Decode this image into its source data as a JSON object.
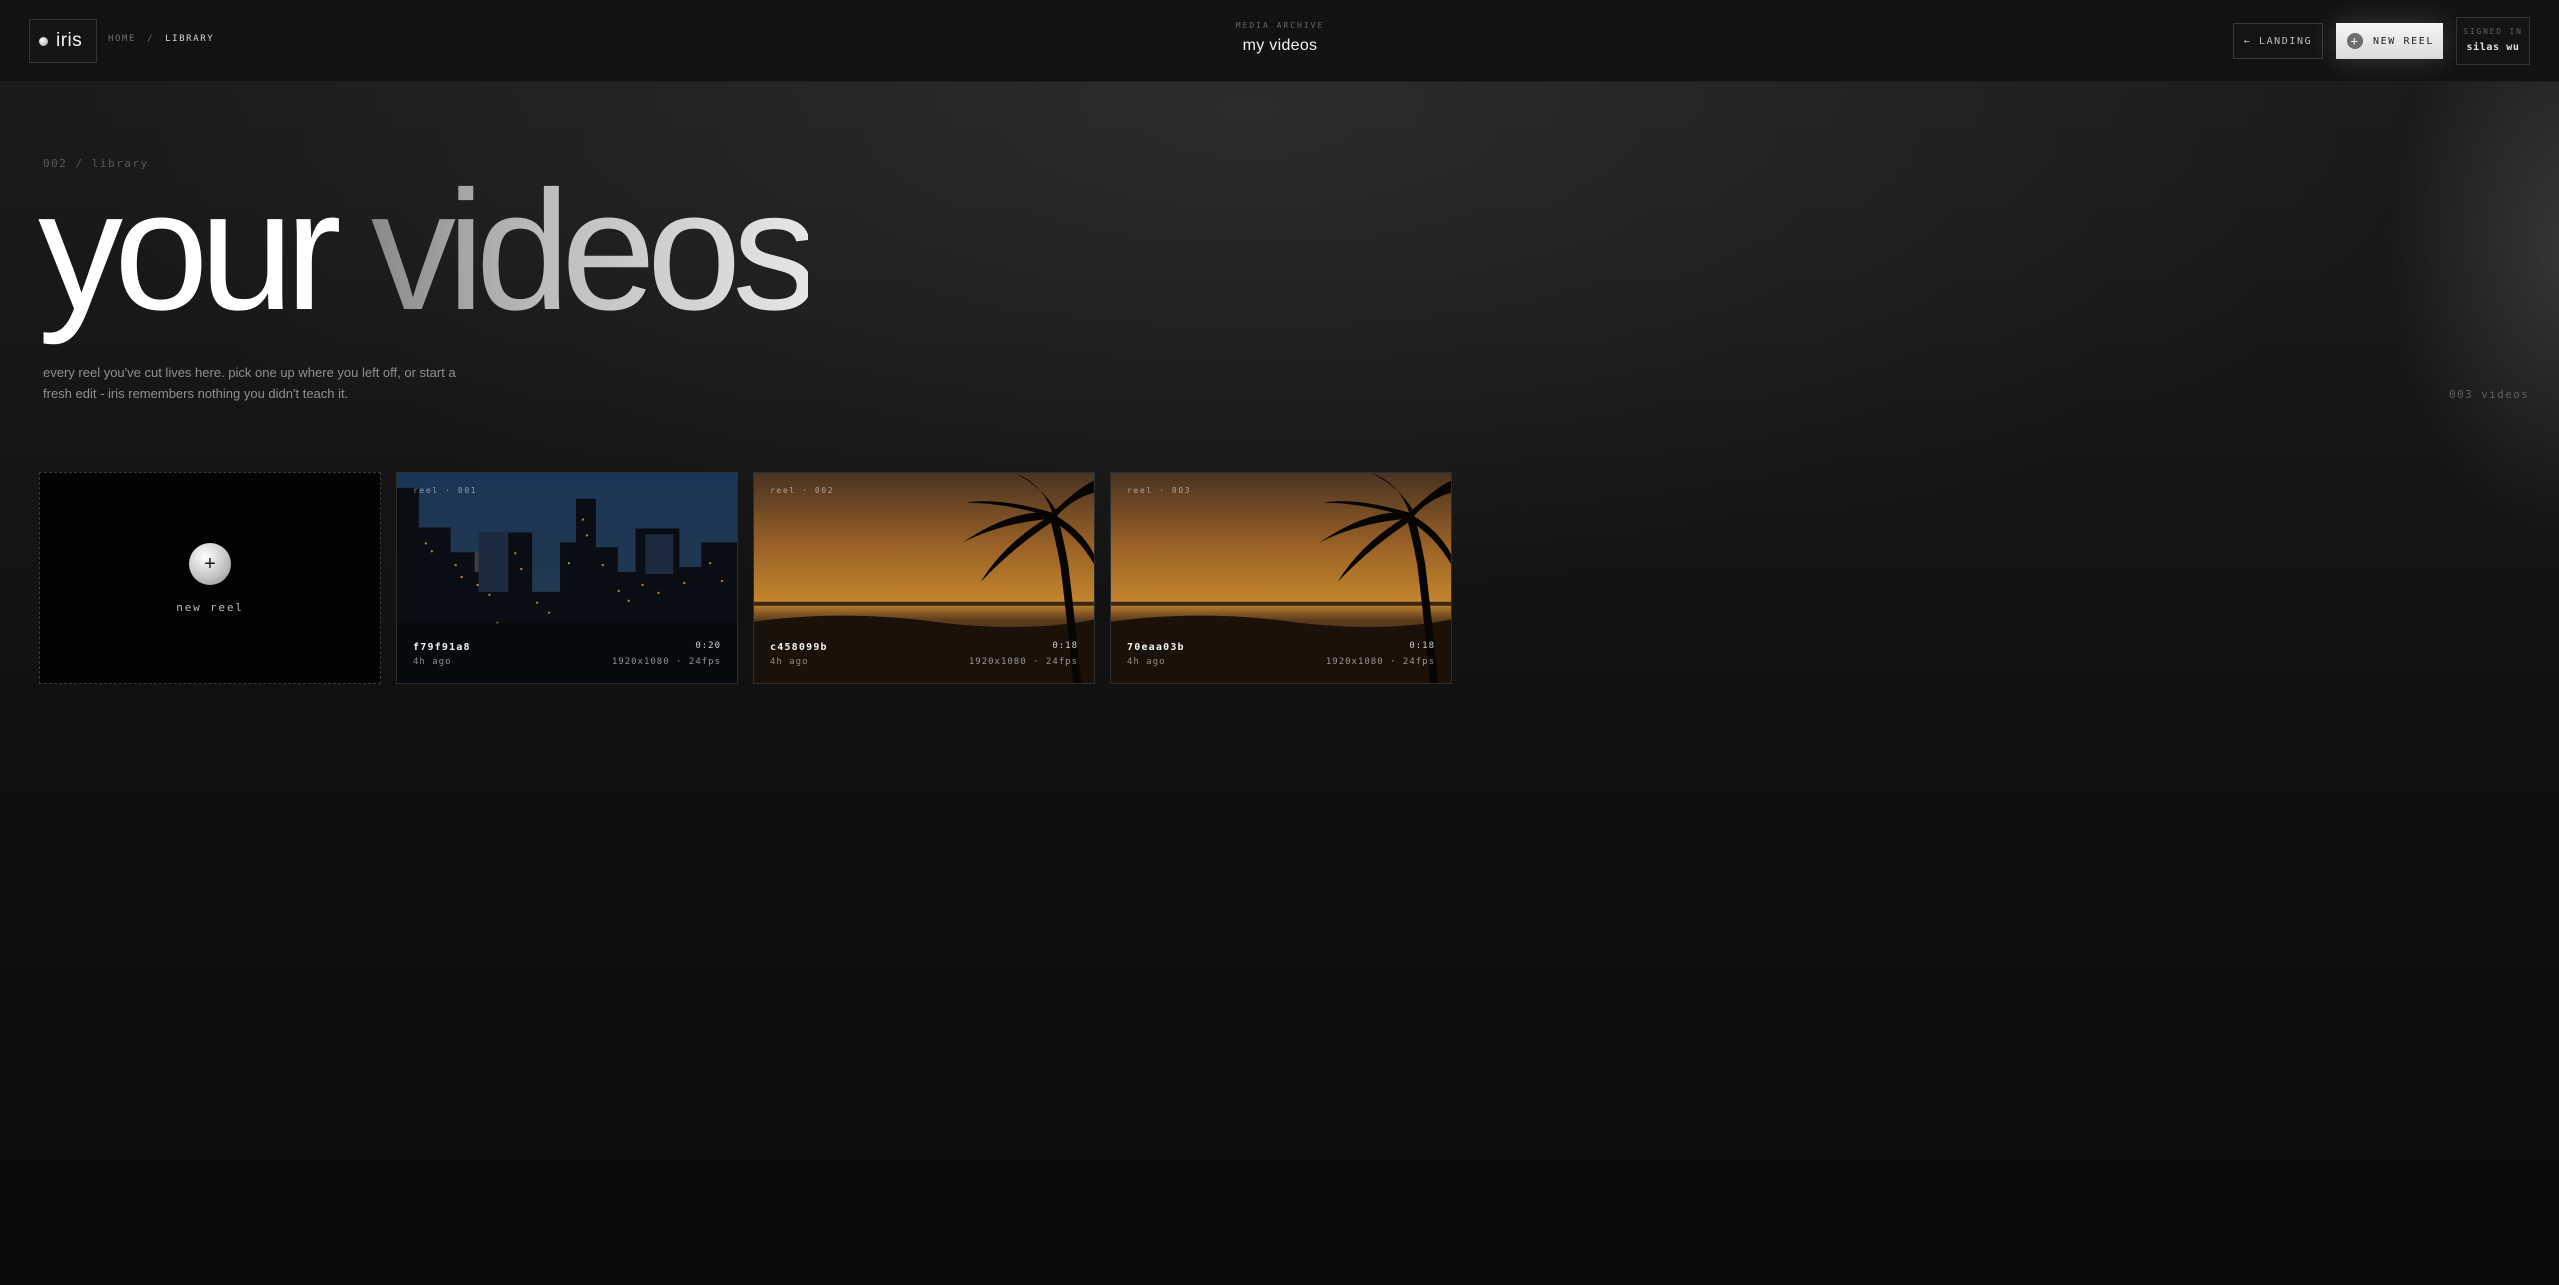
{
  "app": {
    "name": "iris"
  },
  "breadcrumb": {
    "home": "HOME",
    "separator": "/",
    "current": "LIBRARY"
  },
  "header": {
    "eyebrow": "MEDIA ARCHIVE",
    "title": "my videos"
  },
  "actions": {
    "landing_label": "← LANDING",
    "new_reel_label": "NEW REEL",
    "new_reel_icon": "+"
  },
  "user": {
    "eyebrow": "SIGNED IN",
    "name": "silas wu"
  },
  "hero": {
    "eyebrow": "002 / library",
    "title_part1": "your ",
    "title_part2": "videos",
    "description": "every reel you've cut lives here. pick one up where you left off, or start a fresh edit - iris remembers nothing you didn't teach it."
  },
  "library": {
    "count_label": "003 videos"
  },
  "new_reel_card": {
    "icon": "+",
    "label": "new reel"
  },
  "videos": [
    {
      "tag": "reel · 001",
      "id": "f79f91a8",
      "age": "4h ago",
      "duration": "0:20",
      "meta": "1920x1080 · 24fps",
      "thumbnail": "city-skyline-dusk"
    },
    {
      "tag": "reel · 002",
      "id": "c458099b",
      "age": "4h ago",
      "duration": "0:18",
      "meta": "1920x1080 · 24fps",
      "thumbnail": "beach-sunset-palm"
    },
    {
      "tag": "reel · 003",
      "id": "70eaa03b",
      "age": "4h ago",
      "duration": "0:18",
      "meta": "1920x1080 · 24fps",
      "thumbnail": "beach-sunset-palm"
    }
  ]
}
